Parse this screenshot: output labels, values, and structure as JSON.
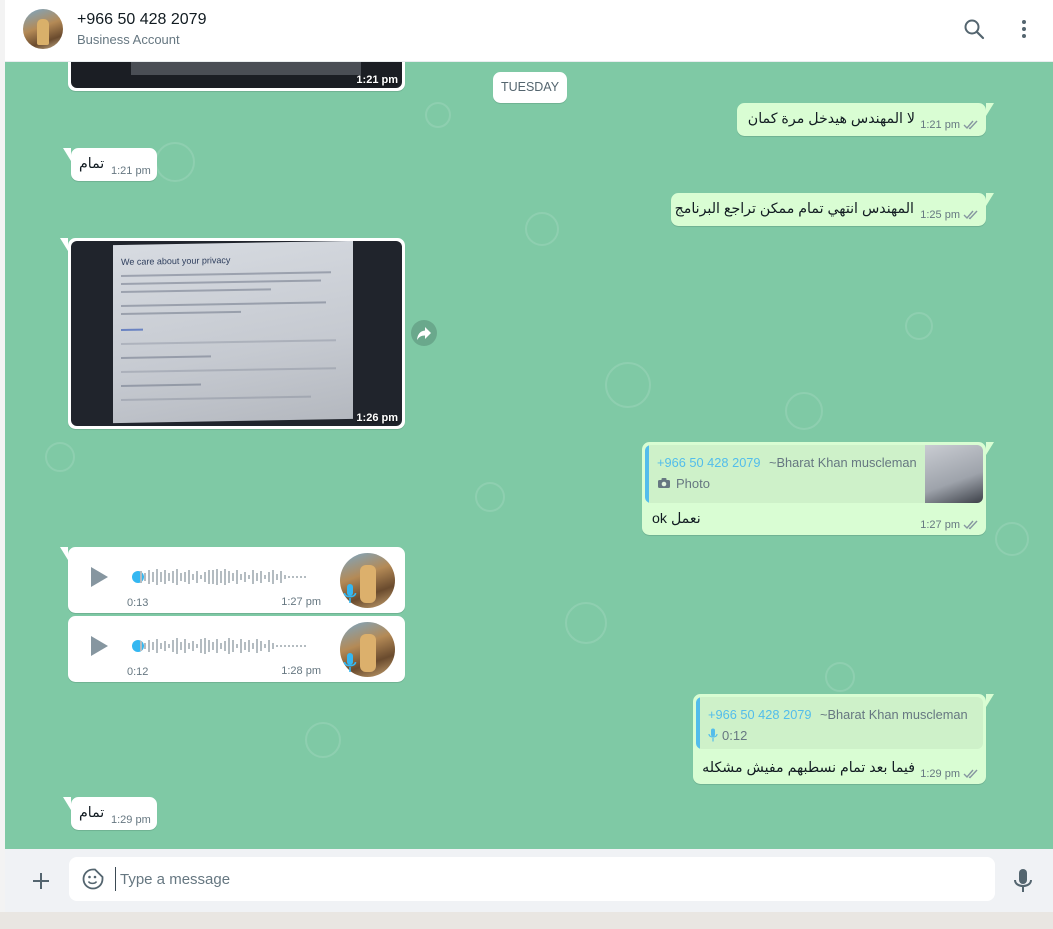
{
  "header": {
    "contact_name": "+966 50 428 2079",
    "contact_subtitle": "Business Account",
    "icons": [
      "search-icon",
      "menu-icon"
    ]
  },
  "chat": {
    "date_separator": "TUESDAY",
    "messages": [
      {
        "id": "img1",
        "type": "image",
        "direction": "incoming",
        "time": "1:21 pm"
      },
      {
        "id": "out1",
        "type": "text",
        "direction": "outgoing",
        "text": "لا المهندس هيدخل مرة كمان",
        "time": "1:21 pm",
        "status": "read"
      },
      {
        "id": "in1",
        "type": "text",
        "direction": "incoming",
        "text": "تمام",
        "time": "1:21 pm"
      },
      {
        "id": "out2",
        "type": "text",
        "direction": "outgoing",
        "text": "المهندس انتهي تمام ممكن تراجع البرنامج",
        "time": "1:25 pm",
        "status": "read"
      },
      {
        "id": "img2",
        "type": "image",
        "direction": "incoming",
        "time": "1:26 pm",
        "image_caption_visible": "We care about your privacy"
      },
      {
        "id": "out3",
        "type": "reply",
        "direction": "outgoing",
        "quote": {
          "phone": "+966 50 428 2079",
          "name": "~Bharat Khan muscleman",
          "body": "Photo",
          "body_icon": "camera-icon"
        },
        "text": "ok نعمل",
        "time": "1:27 pm",
        "status": "read"
      },
      {
        "id": "voice1",
        "type": "voice",
        "direction": "incoming",
        "duration": "0:13",
        "time": "1:27 pm"
      },
      {
        "id": "voice2",
        "type": "voice",
        "direction": "incoming",
        "duration": "0:12",
        "time": "1:28 pm"
      },
      {
        "id": "out4",
        "type": "reply",
        "direction": "outgoing",
        "quote": {
          "phone": "+966 50 428 2079",
          "name": "~Bharat Khan muscleman",
          "body": "0:12",
          "body_icon": "mic-icon"
        },
        "text": "فيما بعد تمام نسطبهم مفيش مشكله",
        "time": "1:29 pm",
        "status": "read"
      },
      {
        "id": "in2",
        "type": "text",
        "direction": "incoming",
        "text": "تمام",
        "time": "1:29 pm"
      }
    ]
  },
  "composer": {
    "placeholder": "Type a message",
    "icons": [
      "plus-icon",
      "sticker-icon",
      "microphone-icon"
    ]
  },
  "colors": {
    "chat_background": "#7fc9a5",
    "outgoing_bubble": "#d9fdd3",
    "incoming_bubble": "#ffffff",
    "quote_accent": "#53bdeb",
    "read_ticks": "#8696a0",
    "voice_progress": "#34b7f1"
  }
}
